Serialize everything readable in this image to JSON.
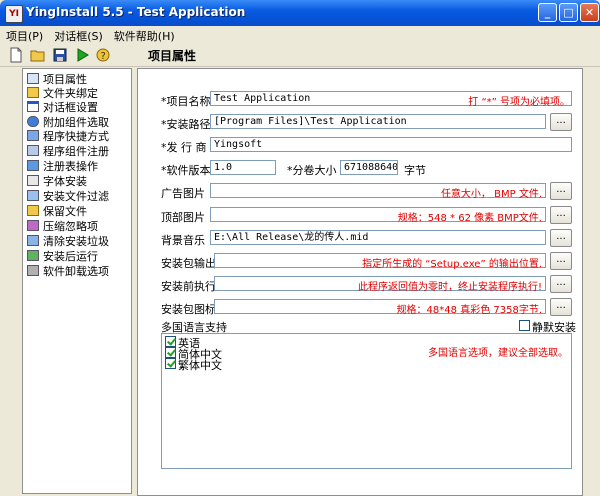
{
  "window": {
    "title": "YingInstall 5.5 - Test Application",
    "app_icon": "YI"
  },
  "menu": [
    "项目(P)",
    "对话框(S)",
    "软件帮助(H)"
  ],
  "page_title": "项目属性",
  "sidebar": [
    {
      "label": "项目属性",
      "icon": "grid-icon"
    },
    {
      "label": "文件夹绑定",
      "icon": "folder-icon"
    },
    {
      "label": "对话框设置",
      "icon": "dialog-icon"
    },
    {
      "label": "附加组件选取",
      "icon": "component-icon"
    },
    {
      "label": "程序快捷方式",
      "icon": "shortcut-icon"
    },
    {
      "label": "程序组件注册",
      "icon": "register-icon"
    },
    {
      "label": "注册表操作",
      "icon": "registry-icon"
    },
    {
      "label": "字体安装",
      "icon": "font-icon"
    },
    {
      "label": "安装文件过滤",
      "icon": "filter-icon"
    },
    {
      "label": "保留文件",
      "icon": "keep-file-icon"
    },
    {
      "label": "压缩忽略项",
      "icon": "compress-icon"
    },
    {
      "label": "清除安装垃圾",
      "icon": "clean-icon"
    },
    {
      "label": "安装后运行",
      "icon": "run-icon"
    },
    {
      "label": "软件卸载选项",
      "icon": "uninstall-icon"
    }
  ],
  "form": {
    "project_name": {
      "label": "*项目名称",
      "value": "Test Application",
      "hint": "打 “*” 号项为必填项。"
    },
    "install_path": {
      "label": "*安装路径",
      "value": "[Program Files]\\Test Application",
      "browse": "..."
    },
    "publisher": {
      "label": "*发 行 商",
      "value": "Yingsoft"
    },
    "version": {
      "label": "*软件版本",
      "value": "1.0"
    },
    "volume_size": {
      "label": "*分卷大小",
      "value": "671088640",
      "unit": "字节"
    },
    "ad_image": {
      "label": "广告图片",
      "value": "",
      "hint": "任意大小， BMP 文件.",
      "browse": "..."
    },
    "top_image": {
      "label": "顶部图片",
      "value": "",
      "hint": "规格：548 * 62 像素 BMP文件.",
      "browse": "..."
    },
    "bg_music": {
      "label": "背景音乐",
      "value": "E:\\All Release\\龙的传人.mid",
      "browse": "..."
    },
    "package_output": {
      "label": "安装包输出",
      "value": "",
      "hint": "指定所生成的 “Setup.exe” 的输出位置.",
      "browse": "..."
    },
    "pre_install": {
      "label": "安装前执行",
      "value": "",
      "hint": "此程序返回值为零时，终止安装程序执行!",
      "browse": "..."
    },
    "package_icon": {
      "label": "安装包图标",
      "value": "",
      "hint": "规格：48*48 真彩色 7358字节.",
      "browse": "..."
    }
  },
  "languages": {
    "label": "多国语言支持",
    "silent_install": {
      "label": "静默安装",
      "checked": false
    },
    "items": [
      {
        "label": "英语",
        "checked": true
      },
      {
        "label": "简体中文",
        "checked": true
      },
      {
        "label": "繁体中文",
        "checked": true
      }
    ],
    "hint": "多国语言选项，建议全部选取。"
  }
}
